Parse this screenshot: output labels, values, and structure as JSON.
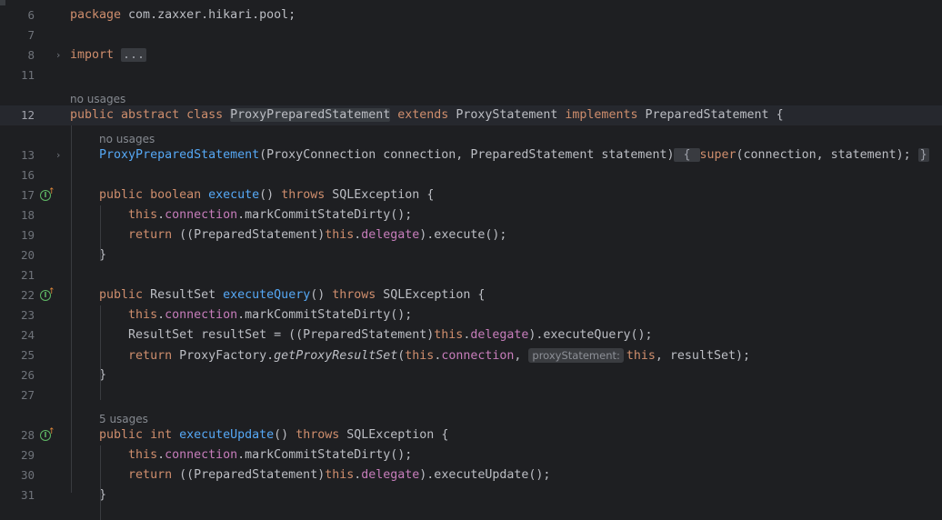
{
  "editor": {
    "lines": [
      {
        "num": "6",
        "tokens": [
          {
            "t": "package ",
            "c": "kw"
          },
          {
            "t": "com.zaxxer.hikari.pool;",
            "c": ""
          }
        ]
      },
      {
        "num": "7",
        "tokens": []
      },
      {
        "num": "8",
        "fold": true,
        "tokens": [
          {
            "t": "import ",
            "c": "kw"
          },
          {
            "t": "...",
            "c": "fold-box"
          }
        ]
      },
      {
        "num": "11",
        "tokens": []
      },
      {
        "hint": "no usages"
      },
      {
        "num": "12",
        "current": true,
        "tokens": [
          {
            "t": "public abstract class ",
            "c": "kw"
          },
          {
            "t": "ProxyPreparedStatement",
            "c": "hl"
          },
          {
            "t": " ",
            "c": ""
          },
          {
            "t": "extends ",
            "c": "kw"
          },
          {
            "t": "ProxyStatement ",
            "c": ""
          },
          {
            "t": "implements ",
            "c": "kw"
          },
          {
            "t": "PreparedStatement {",
            "c": ""
          }
        ]
      },
      {
        "hint": "no usages",
        "indent": 1
      },
      {
        "num": "13",
        "fold": true,
        "tokens": [
          {
            "t": "    ",
            "c": ""
          },
          {
            "t": "ProxyPreparedStatement",
            "c": "fn"
          },
          {
            "t": "(ProxyConnection connection, PreparedStatement statement)",
            "c": ""
          },
          {
            "t": " { ",
            "c": "fold-box"
          },
          {
            "t": "super",
            "c": "kw"
          },
          {
            "t": "(connection, statement); ",
            "c": ""
          },
          {
            "t": "}",
            "c": "fold-box"
          }
        ]
      },
      {
        "num": "16",
        "tokens": []
      },
      {
        "num": "17",
        "marker": true,
        "tokens": [
          {
            "t": "    ",
            "c": ""
          },
          {
            "t": "public boolean ",
            "c": "kw"
          },
          {
            "t": "execute",
            "c": "fn"
          },
          {
            "t": "() ",
            "c": ""
          },
          {
            "t": "throws ",
            "c": "kw"
          },
          {
            "t": "SQLException {",
            "c": ""
          }
        ]
      },
      {
        "num": "18",
        "tokens": [
          {
            "t": "        ",
            "c": ""
          },
          {
            "t": "this",
            "c": "kw"
          },
          {
            "t": ".",
            "c": ""
          },
          {
            "t": "connection",
            "c": "fld"
          },
          {
            "t": ".markCommitStateDirty();",
            "c": ""
          }
        ]
      },
      {
        "num": "19",
        "tokens": [
          {
            "t": "        ",
            "c": ""
          },
          {
            "t": "return ",
            "c": "kw"
          },
          {
            "t": "((PreparedStatement)",
            "c": ""
          },
          {
            "t": "this",
            "c": "kw"
          },
          {
            "t": ".",
            "c": ""
          },
          {
            "t": "delegate",
            "c": "fld"
          },
          {
            "t": ").execute();",
            "c": ""
          }
        ]
      },
      {
        "num": "20",
        "tokens": [
          {
            "t": "    }",
            "c": ""
          }
        ]
      },
      {
        "num": "21",
        "tokens": []
      },
      {
        "num": "22",
        "marker": true,
        "tokens": [
          {
            "t": "    ",
            "c": ""
          },
          {
            "t": "public ",
            "c": "kw"
          },
          {
            "t": "ResultSet ",
            "c": ""
          },
          {
            "t": "executeQuery",
            "c": "fn"
          },
          {
            "t": "() ",
            "c": ""
          },
          {
            "t": "throws ",
            "c": "kw"
          },
          {
            "t": "SQLException {",
            "c": ""
          }
        ]
      },
      {
        "num": "23",
        "tokens": [
          {
            "t": "        ",
            "c": ""
          },
          {
            "t": "this",
            "c": "kw"
          },
          {
            "t": ".",
            "c": ""
          },
          {
            "t": "connection",
            "c": "fld"
          },
          {
            "t": ".markCommitStateDirty();",
            "c": ""
          }
        ]
      },
      {
        "num": "24",
        "tokens": [
          {
            "t": "        ",
            "c": ""
          },
          {
            "t": "ResultSet resultSet = ((PreparedStatement)",
            "c": ""
          },
          {
            "t": "this",
            "c": "kw"
          },
          {
            "t": ".",
            "c": ""
          },
          {
            "t": "delegate",
            "c": "fld"
          },
          {
            "t": ").executeQuery();",
            "c": ""
          }
        ]
      },
      {
        "num": "25",
        "tokens": [
          {
            "t": "        ",
            "c": ""
          },
          {
            "t": "return ",
            "c": "kw"
          },
          {
            "t": "ProxyFactory.",
            "c": ""
          },
          {
            "t": "getProxyResultSet",
            "c": "it"
          },
          {
            "t": "(",
            "c": ""
          },
          {
            "t": "this",
            "c": "kw"
          },
          {
            "t": ".",
            "c": ""
          },
          {
            "t": "connection",
            "c": "fld"
          },
          {
            "t": ", ",
            "c": ""
          },
          {
            "t": "proxyStatement:",
            "c": "inlay"
          },
          {
            "t": "this",
            "c": "kw"
          },
          {
            "t": ", resultSet);",
            "c": ""
          }
        ]
      },
      {
        "num": "26",
        "tokens": [
          {
            "t": "    }",
            "c": ""
          }
        ]
      },
      {
        "num": "27",
        "tokens": []
      },
      {
        "hint": "5 usages",
        "indent": 1
      },
      {
        "num": "28",
        "marker": true,
        "tokens": [
          {
            "t": "    ",
            "c": ""
          },
          {
            "t": "public int ",
            "c": "kw"
          },
          {
            "t": "executeUpdate",
            "c": "fn"
          },
          {
            "t": "() ",
            "c": ""
          },
          {
            "t": "throws ",
            "c": "kw"
          },
          {
            "t": "SQLException {",
            "c": ""
          }
        ]
      },
      {
        "num": "29",
        "tokens": [
          {
            "t": "        ",
            "c": ""
          },
          {
            "t": "this",
            "c": "kw"
          },
          {
            "t": ".",
            "c": ""
          },
          {
            "t": "connection",
            "c": "fld"
          },
          {
            "t": ".markCommitStateDirty();",
            "c": ""
          }
        ]
      },
      {
        "num": "30",
        "tokens": [
          {
            "t": "        ",
            "c": ""
          },
          {
            "t": "return ",
            "c": "kw"
          },
          {
            "t": "((PreparedStatement)",
            "c": ""
          },
          {
            "t": "this",
            "c": "kw"
          },
          {
            "t": ".",
            "c": ""
          },
          {
            "t": "delegate",
            "c": "fld"
          },
          {
            "t": ").executeUpdate();",
            "c": ""
          }
        ]
      },
      {
        "num": "31",
        "tokens": [
          {
            "t": "    }",
            "c": ""
          }
        ]
      }
    ]
  },
  "colors": {
    "background": "#1e1f22",
    "keyword": "#cf8e6d",
    "function": "#56a8f5",
    "field": "#c77dbb",
    "text": "#bcbec4",
    "line_number": "#6f737a"
  }
}
